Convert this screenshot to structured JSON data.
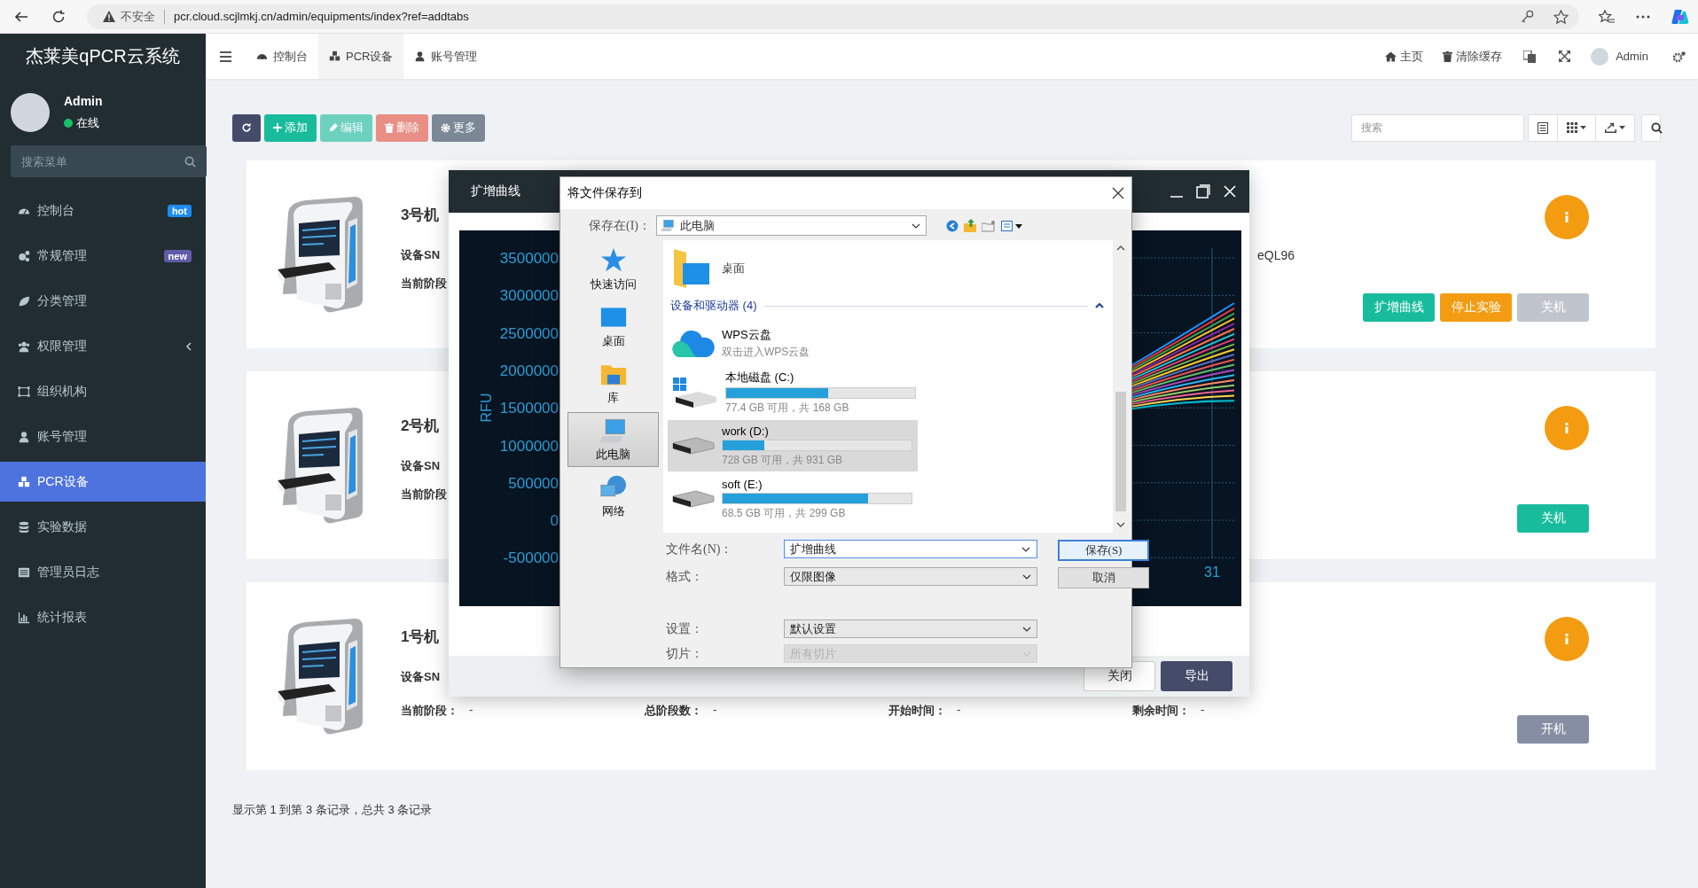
{
  "browser": {
    "security_label": "不安全",
    "url": "pcr.cloud.scjlmkj.cn/admin/equipments/index?ref=addtabs"
  },
  "sidebar": {
    "logo": "杰莱美qPCR云系统",
    "user": {
      "name": "Admin",
      "status": "在线"
    },
    "search": {
      "placeholder": "搜索菜单"
    },
    "items": [
      {
        "label": "控制台",
        "selected": false,
        "expandable": false,
        "badge": {
          "text": "hot",
          "color": "#1e8cf0"
        }
      },
      {
        "label": "常规管理",
        "selected": false,
        "expandable": false,
        "badge": {
          "text": "new",
          "color": "#605ca8"
        }
      },
      {
        "label": "分类管理",
        "selected": false,
        "expandable": false
      },
      {
        "label": "权限管理",
        "selected": false,
        "expandable": true
      },
      {
        "label": "组织机构",
        "selected": false,
        "expandable": false
      },
      {
        "label": "账号管理",
        "selected": false,
        "expandable": false
      },
      {
        "label": "PCR设备",
        "selected": true,
        "expandable": false
      },
      {
        "label": "实验数据",
        "selected": false,
        "expandable": false
      },
      {
        "label": "管理员日志",
        "selected": false,
        "expandable": false
      },
      {
        "label": "统计报表",
        "selected": false,
        "expandable": false
      }
    ]
  },
  "topnav": {
    "tabs": [
      {
        "label": "控制台",
        "selected": false
      },
      {
        "label": "PCR设备",
        "selected": true
      },
      {
        "label": "账号管理",
        "selected": false
      }
    ],
    "links": [
      {
        "label": "主页"
      },
      {
        "label": "清除缓存"
      }
    ],
    "user": "Admin"
  },
  "toolbar": {
    "buttons": [
      {
        "kind": "refresh",
        "disabled": false
      },
      {
        "kind": "add",
        "label": "添加",
        "disabled": false
      },
      {
        "kind": "edit",
        "label": "编辑",
        "disabled": true
      },
      {
        "kind": "delete",
        "label": "删除",
        "disabled": true
      },
      {
        "kind": "more",
        "label": "更多",
        "disabled": false
      }
    ],
    "search": {
      "placeholder": "搜索"
    }
  },
  "devices": [
    {
      "name": "3号机",
      "sn": {
        "label": "设备SN",
        "value": "eQL96"
      },
      "stats": [
        {
          "label": "当前阶段"
        }
      ],
      "buttons": [
        {
          "label": "扩增曲线",
          "kind": "success",
          "disabled": false
        },
        {
          "label": "停止实验",
          "kind": "warning",
          "disabled": false
        },
        {
          "label": "关机",
          "kind": "success",
          "disabled": true
        }
      ]
    },
    {
      "name": "2号机",
      "sn": {
        "label": "设备SN"
      },
      "stats": [
        {
          "label": "当前阶段"
        }
      ],
      "buttons": [
        {
          "label": "关机",
          "kind": "success",
          "disabled": false
        }
      ]
    },
    {
      "name": "1号机",
      "sn": {
        "label": "设备SN"
      },
      "stats": [
        {
          "label": "当前阶段：",
          "value": "-"
        },
        {
          "label": "总阶段数：",
          "value": "-"
        },
        {
          "label": "开始时间：",
          "value": "-"
        },
        {
          "label": "剩余时间：",
          "value": "-"
        }
      ],
      "buttons": [
        {
          "label": "开机",
          "kind": "neutral",
          "disabled": false
        }
      ]
    }
  ],
  "pagination": "显示第 1 到第 3 条记录，总共 3 条记录",
  "amp_dialog": {
    "title": "扩增曲线",
    "chart": {
      "ylabel": "RFU",
      "y_tick_labels": [
        "3500000",
        "3000000",
        "2500000",
        "2000000",
        "1500000",
        "1000000",
        "500000",
        "0",
        "-500000"
      ],
      "x_tick_labels": [
        "31"
      ]
    },
    "buttons": [
      {
        "label": "关闭",
        "kind": "default"
      },
      {
        "label": "导出",
        "kind": "primary"
      }
    ]
  },
  "save_dialog": {
    "title": "将文件保存到",
    "location_label": "保存在(I)：",
    "location": "此电脑",
    "places": [
      {
        "label": "快速访问",
        "selected": false
      },
      {
        "label": "桌面",
        "selected": false
      },
      {
        "label": "库",
        "selected": false
      },
      {
        "label": "此电脑",
        "selected": true
      },
      {
        "label": "网络",
        "selected": false
      }
    ],
    "folders": [
      {
        "name": "桌面"
      }
    ],
    "group": {
      "label": "设备和驱动器 (4)",
      "expanded": true
    },
    "drives": [
      {
        "kind": "cloud",
        "name": "WPS云盘",
        "detail": "双击进入WPS云盘",
        "selected": false
      },
      {
        "kind": "system",
        "name": "本地磁盘 (C:)",
        "level": 0.54,
        "detail": "77.4 GB 可用，共 168 GB",
        "selected": false
      },
      {
        "kind": "disk",
        "name": "work (D:)",
        "level": 0.22,
        "detail": "728 GB 可用，共 931 GB",
        "selected": true
      },
      {
        "kind": "disk",
        "name": "soft (E:)",
        "level": 0.77,
        "detail": "68.5 GB 可用，共 299 GB",
        "selected": false
      }
    ],
    "fields": [
      {
        "label": "文件名(N)：",
        "value": "扩增曲线",
        "kind": "input",
        "disabled": false
      },
      {
        "label": "格式：",
        "value": "仅限图像",
        "kind": "select",
        "disabled": false
      },
      {
        "label": "设置：",
        "value": "默认设置",
        "kind": "select",
        "disabled": false
      },
      {
        "label": "切片：",
        "value": "所有切片",
        "kind": "select",
        "disabled": true
      }
    ],
    "buttons": [
      {
        "label": "保存(S)",
        "kind": "default_action"
      },
      {
        "label": "取消",
        "kind": "normal"
      }
    ]
  }
}
